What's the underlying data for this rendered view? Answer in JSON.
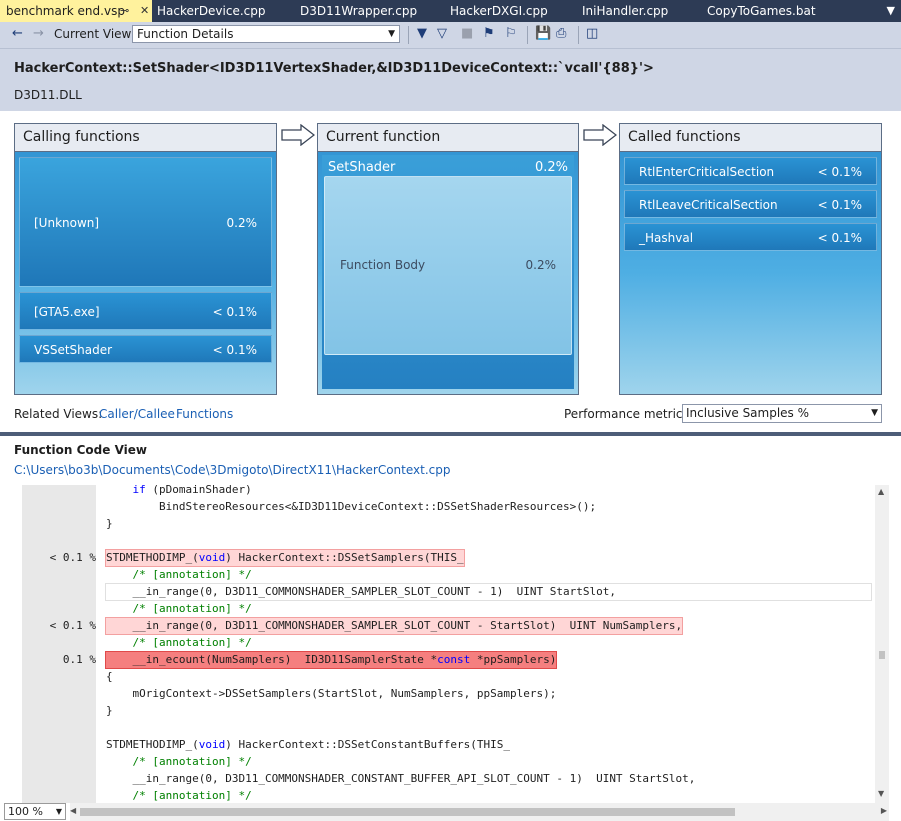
{
  "tabs": [
    {
      "label": "benchmark end.vsp",
      "active": true
    },
    {
      "label": "HackerDevice.cpp"
    },
    {
      "label": "D3D11Wrapper.cpp"
    },
    {
      "label": "HackerDXGI.cpp"
    },
    {
      "label": "IniHandler.cpp"
    },
    {
      "label": "CopyToGames.bat"
    }
  ],
  "toolbar": {
    "current_view_label": "Current View:",
    "current_view_value": "Function Details"
  },
  "header": {
    "function_name": "HackerContext::SetShader<ID3D11VertexShader,&ID3D11DeviceContext::`vcall'{88}'>",
    "module": "D3D11.DLL"
  },
  "calling": {
    "title": "Calling functions",
    "items": [
      {
        "name": "[Unknown]",
        "value": "0.2%"
      },
      {
        "name": "[GTA5.exe]",
        "value": "< 0.1%"
      },
      {
        "name": "VSSetShader",
        "value": "< 0.1%"
      }
    ]
  },
  "current": {
    "title": "Current function",
    "name": "SetShader",
    "value": "0.2%",
    "body_label": "Function Body",
    "body_value": "0.2%"
  },
  "called": {
    "title": "Called functions",
    "items": [
      {
        "name": "RtlEnterCriticalSection",
        "value": "< 0.1%"
      },
      {
        "name": "RtlLeaveCriticalSection",
        "value": "< 0.1%"
      },
      {
        "name": "_Hashval",
        "value": "< 0.1%"
      }
    ]
  },
  "related": {
    "label": "Related Views:",
    "links": [
      "Caller/Callee",
      "Functions"
    ],
    "metric_label": "Performance metric:",
    "metric_value": "Inclusive Samples %"
  },
  "code_view": {
    "title": "Function Code View",
    "path": "C:\\Users\\bo3b\\Documents\\Code\\3Dmigoto\\DirectX11\\HackerContext.cpp"
  },
  "code_lines": [
    {
      "parts": [
        {
          "t": "    "
        },
        {
          "t": "if",
          "c": "kw"
        },
        {
          "t": " (pDomainShader)"
        }
      ]
    },
    {
      "parts": [
        {
          "t": "        BindStereoResources<&ID3D11DeviceContext::DSSetShaderResources>();"
        }
      ]
    },
    {
      "parts": [
        {
          "t": "}"
        }
      ]
    },
    {
      "parts": [
        {
          "t": ""
        }
      ]
    },
    {
      "pct": "< 0.1 %",
      "hl": "light",
      "parts": [
        {
          "t": "STDMETHODIMP_("
        },
        {
          "t": "void",
          "c": "kw"
        },
        {
          "t": ") HackerContext::DSSetSamplers(THIS_"
        }
      ]
    },
    {
      "parts": [
        {
          "t": "    "
        },
        {
          "t": "/* [annotation] */",
          "c": "cm"
        }
      ]
    },
    {
      "hl": "box",
      "parts": [
        {
          "t": "    __in_range(0, D3D11_COMMONSHADER_SAMPLER_SLOT_COUNT - 1)  UINT StartSlot,"
        }
      ]
    },
    {
      "parts": [
        {
          "t": "    "
        },
        {
          "t": "/* [annotation] */",
          "c": "cm"
        }
      ]
    },
    {
      "pct": "< 0.1 %",
      "hl": "light",
      "parts": [
        {
          "t": "    __in_range(0, D3D11_COMMONSHADER_SAMPLER_SLOT_COUNT - StartSlot)  UINT NumSamplers,"
        }
      ]
    },
    {
      "parts": [
        {
          "t": "    "
        },
        {
          "t": "/* [annotation] */",
          "c": "cm"
        }
      ]
    },
    {
      "pct": "0.1 %",
      "hl": "strong",
      "parts": [
        {
          "t": "    __in_ecount(NumSamplers)  ID3D11SamplerState *"
        },
        {
          "t": "const",
          "c": "kw"
        },
        {
          "t": " *ppSamplers)"
        }
      ]
    },
    {
      "parts": [
        {
          "t": "{"
        }
      ]
    },
    {
      "parts": [
        {
          "t": "    mOrigContext->DSSetSamplers(StartSlot, NumSamplers, ppSamplers);"
        }
      ]
    },
    {
      "parts": [
        {
          "t": "}"
        }
      ]
    },
    {
      "parts": [
        {
          "t": ""
        }
      ]
    },
    {
      "parts": [
        {
          "t": "STDMETHODIMP_("
        },
        {
          "t": "void",
          "c": "kw"
        },
        {
          "t": ") HackerContext::DSSetConstantBuffers(THIS_"
        }
      ]
    },
    {
      "parts": [
        {
          "t": "    "
        },
        {
          "t": "/* [annotation] */",
          "c": "cm"
        }
      ]
    },
    {
      "parts": [
        {
          "t": "    __in_range(0, D3D11_COMMONSHADER_CONSTANT_BUFFER_API_SLOT_COUNT - 1)  UINT StartSlot,"
        }
      ]
    },
    {
      "parts": [
        {
          "t": "    "
        },
        {
          "t": "/* [annotation] */",
          "c": "cm"
        }
      ]
    }
  ],
  "zoom": "100 %"
}
